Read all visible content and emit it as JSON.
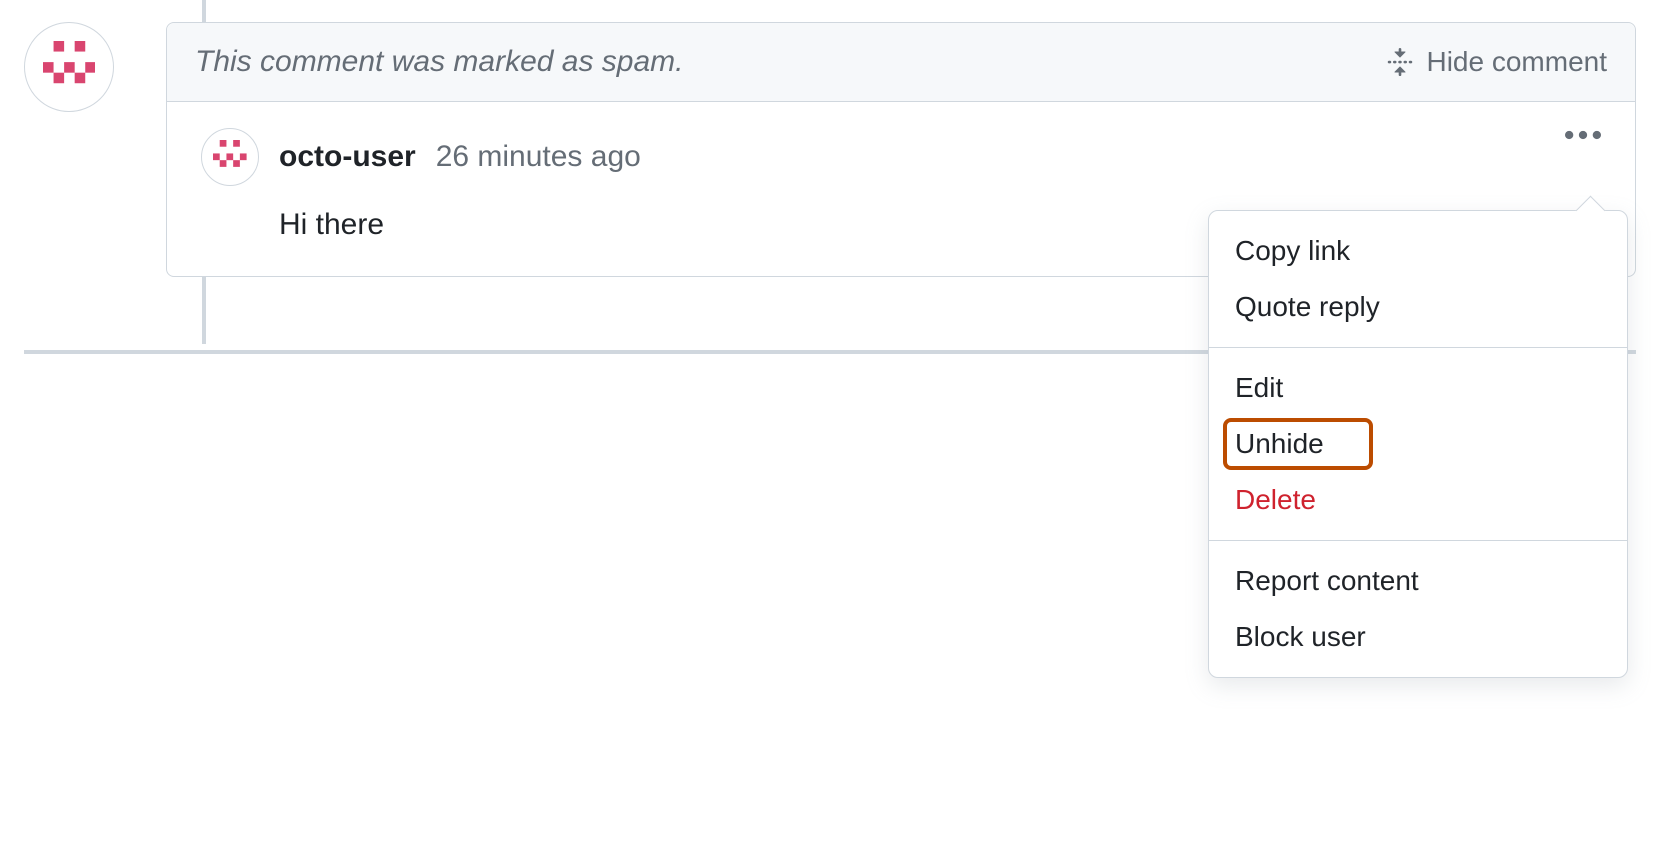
{
  "banner": {
    "spam_text": "This comment was marked as spam.",
    "hide_label": "Hide comment"
  },
  "comment": {
    "username": "octo-user",
    "timestamp": "26 minutes ago",
    "body": "Hi there"
  },
  "menu": {
    "copy_link": "Copy link",
    "quote_reply": "Quote reply",
    "edit": "Edit",
    "unhide": "Unhide",
    "delete": "Delete",
    "report": "Report content",
    "block": "Block user"
  },
  "colors": {
    "border": "#d0d7de",
    "muted_text": "#656d76",
    "danger": "#cf222e",
    "highlight": "#bc4c00",
    "banner_bg": "#f6f8fa"
  }
}
